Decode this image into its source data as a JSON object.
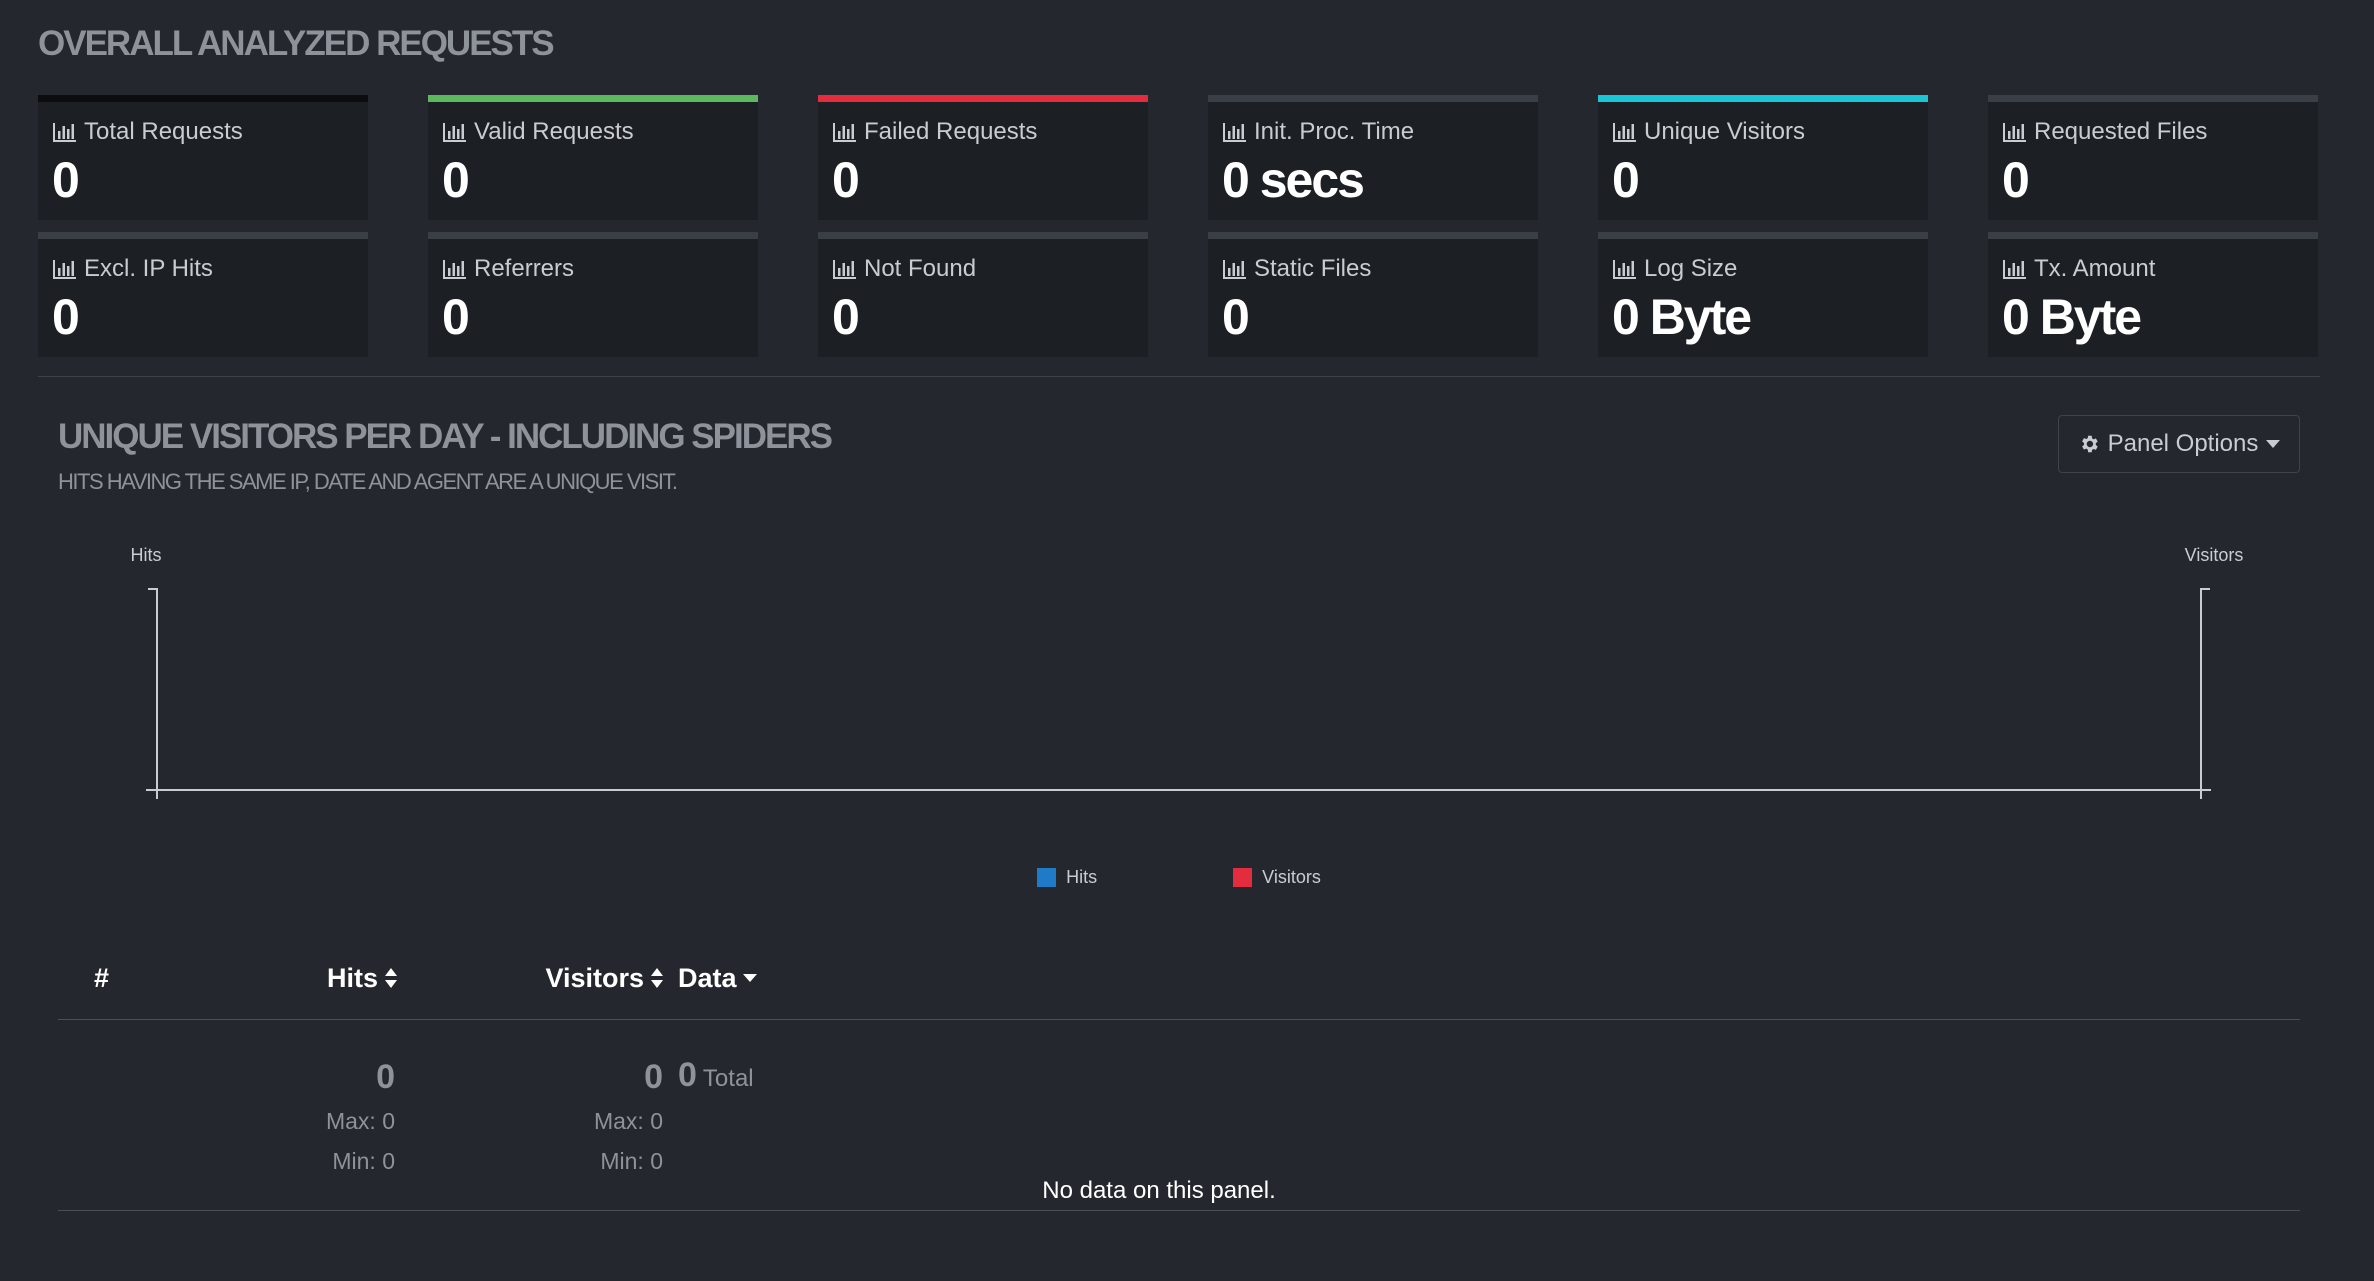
{
  "overview": {
    "title": "OVERALL ANALYZED REQUESTS",
    "cards": [
      {
        "label": "Total Requests",
        "value": "0"
      },
      {
        "label": "Valid Requests",
        "value": "0"
      },
      {
        "label": "Failed Requests",
        "value": "0"
      },
      {
        "label": "Init. Proc. Time",
        "value": "0 secs"
      },
      {
        "label": "Unique Visitors",
        "value": "0"
      },
      {
        "label": "Requested Files",
        "value": "0"
      },
      {
        "label": "Excl. IP Hits",
        "value": "0"
      },
      {
        "label": "Referrers",
        "value": "0"
      },
      {
        "label": "Not Found",
        "value": "0"
      },
      {
        "label": "Static Files",
        "value": "0"
      },
      {
        "label": "Log Size",
        "value": "0 Byte"
      },
      {
        "label": "Tx. Amount",
        "value": "0 Byte"
      }
    ],
    "accent_colors": {
      "total": "#0b0c0e",
      "valid": "#5cb85c",
      "failed": "#e32d3e",
      "visitors": "#18c6d6",
      "default": "#3a3e45"
    }
  },
  "panel": {
    "title": "UNIQUE VISITORS PER DAY - INCLUDING SPIDERS",
    "subtitle": "HITS HAVING THE SAME IP, DATE AND AGENT ARE A UNIQUE VISIT.",
    "options_label": "Panel Options",
    "icons": [
      "gear-icon",
      "caret-down-icon"
    ]
  },
  "chart_data": {
    "type": "bar",
    "ylabel_left": "Hits",
    "ylabel_right": "Visitors",
    "categories": [],
    "series": [
      {
        "name": "Hits",
        "values": [],
        "color": "#1f7bc8"
      },
      {
        "name": "Visitors",
        "values": [],
        "color": "#e32d3e"
      }
    ],
    "legend_position": "bottom",
    "grid": false
  },
  "table": {
    "headers": {
      "num": "#",
      "hits": "Hits",
      "visitors": "Visitors",
      "data": "Data"
    },
    "hits": {
      "value": "0",
      "max": "Max: 0",
      "min": "Min: 0"
    },
    "visitors": {
      "value": "0",
      "max": "Max: 0",
      "min": "Min: 0"
    },
    "data": {
      "value": "0",
      "label": "Total"
    },
    "empty_message": "No data on this panel."
  }
}
